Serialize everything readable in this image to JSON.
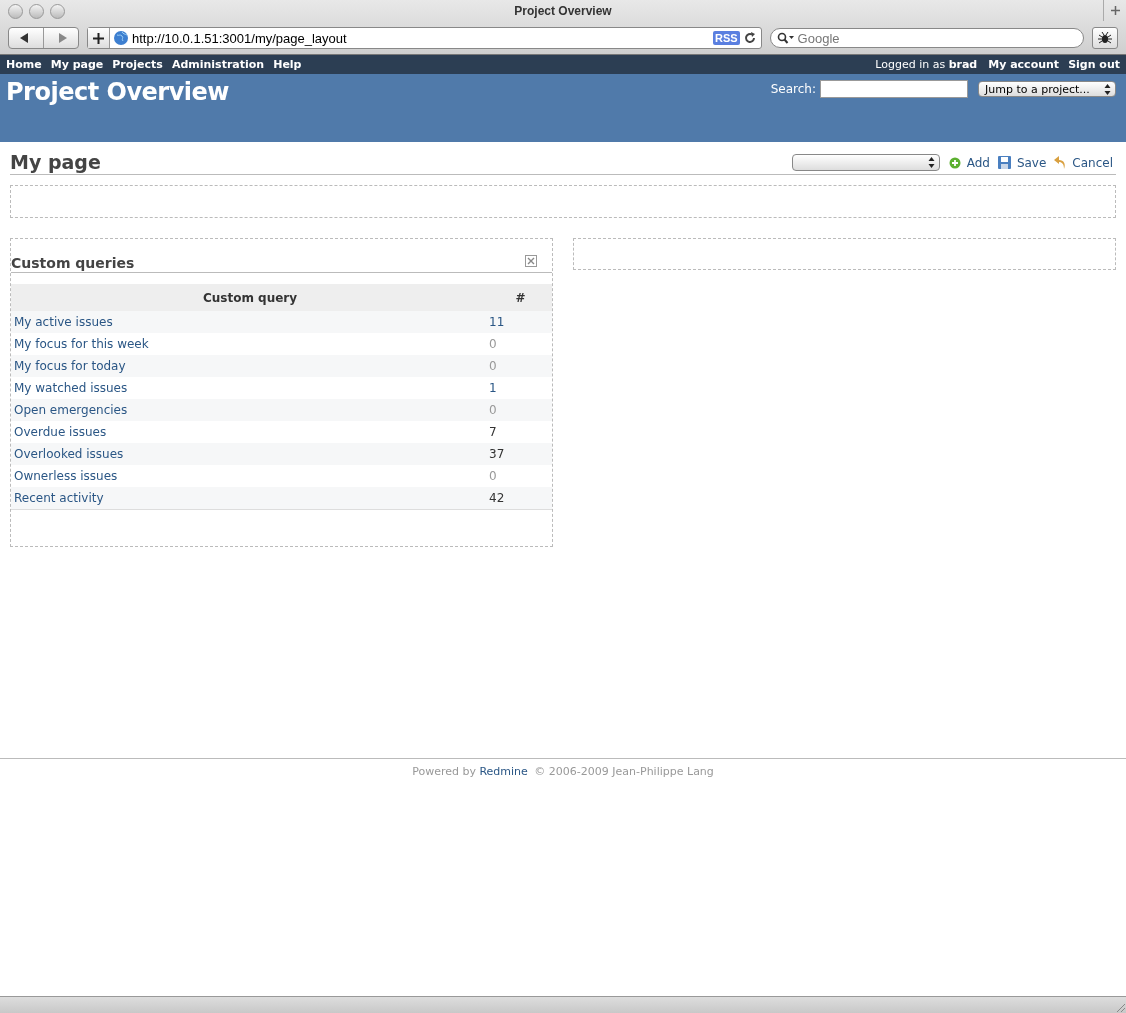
{
  "window": {
    "title": "Project Overview"
  },
  "browser": {
    "address": "http://10.0.1.51:3001/my/page_layout",
    "rss": "RSS",
    "search_placeholder": "Google"
  },
  "top_menu": {
    "items": [
      "Home",
      "My page",
      "Projects",
      "Administration",
      "Help"
    ],
    "logged_in": "Logged in as **brad**",
    "account_links": [
      "My account",
      "Sign out"
    ]
  },
  "header": {
    "title": "Project Overview",
    "search_label": "Search:",
    "jump_select": "Jump to a project..."
  },
  "page": {
    "title": "My page",
    "actions": [
      {
        "kind": "add",
        "label": "Add"
      },
      {
        "kind": "save",
        "label": "Save"
      },
      {
        "kind": "cancel",
        "label": "Cancel"
      }
    ]
  },
  "widget": {
    "title": "Custom queries",
    "columns": [
      "Custom query",
      "#"
    ],
    "rows": [
      {
        "name": "My active issues",
        "count": "11",
        "kind": "link"
      },
      {
        "name": "My focus for this week",
        "count": "0",
        "kind": "muted"
      },
      {
        "name": "My focus for today",
        "count": "0",
        "kind": "muted"
      },
      {
        "name": "My watched issues",
        "count": "1",
        "kind": "link"
      },
      {
        "name": "Open emergencies",
        "count": "0",
        "kind": "muted"
      },
      {
        "name": "Overdue issues",
        "count": "7",
        "kind": "plain"
      },
      {
        "name": "Overlooked issues",
        "count": "37",
        "kind": "plain"
      },
      {
        "name": "Ownerless issues",
        "count": "0",
        "kind": "muted"
      },
      {
        "name": "Recent activity",
        "count": "42",
        "kind": "plain"
      }
    ]
  },
  "footer": {
    "before": "Powered by",
    "link": "Redmine",
    "after": "© 2006-2009 Jean-Philippe Lang"
  }
}
